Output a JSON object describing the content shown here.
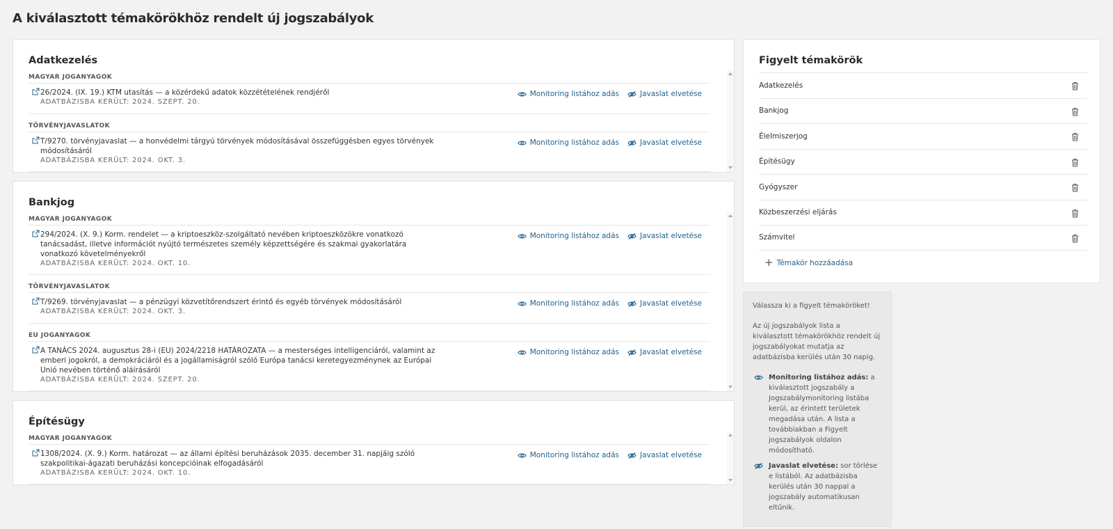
{
  "page_title": "A kiválasztott témakörökhöz rendelt új jogszabályok",
  "action_labels": {
    "monitor": "Monitoring listához adás",
    "reject": "Javaslat elvetése"
  },
  "cards": [
    {
      "title": "Adatkezelés",
      "sections": [
        {
          "label": "MAGYAR JOGANYAGOK",
          "entries": [
            {
              "title": "26/2024. (IX. 19.) KTM utasítás — a közérdekű adatok közzétételének rendjéről",
              "date": "ADATBÁZISBA KERÜLT: 2024. SZEPT. 20."
            }
          ]
        },
        {
          "label": "TÖRVÉNYJAVASLATOK",
          "entries": [
            {
              "title": "T/9270. törvényjavaslat — a honvédelmi tárgyú törvények módosításával összefüggésben egyes törvények módosításáról",
              "date": "ADATBÁZISBA KERÜLT: 2024. OKT. 3."
            }
          ]
        }
      ]
    },
    {
      "title": "Bankjog",
      "sections": [
        {
          "label": "MAGYAR JOGANYAGOK",
          "entries": [
            {
              "title": "294/2024. (X. 9.) Korm. rendelet — a kriptoeszköz-szolgáltató nevében kriptoeszközökre vonatkozó tanácsadást, illetve információt nyújtó természetes személy képzettségére és szakmai gyakorlatára vonatkozó követelményekről",
              "date": "ADATBÁZISBA KERÜLT: 2024. OKT. 10."
            }
          ]
        },
        {
          "label": "TÖRVÉNYJAVASLATOK",
          "entries": [
            {
              "title": "T/9269. törvényjavaslat — a pénzügyi közvetítőrendszert érintő és egyéb törvények módosításáról",
              "date": "ADATBÁZISBA KERÜLT: 2024. OKT. 3."
            }
          ]
        },
        {
          "label": "EU JOGANYAGOK",
          "entries": [
            {
              "title": "A TANÁCS 2024. augusztus 28-i (EU) 2024/2218 HATÁROZATA — a mesterséges intelligenciáról, valamint az emberi jogokról, a demokráciáról és a jogállamiságról szóló Európa tanácsi keretegyezménynek az Európai Unió nevében történő aláírásáról",
              "date": "ADATBÁZISBA KERÜLT: 2024. SZEPT. 20."
            }
          ]
        }
      ]
    },
    {
      "title": "Építésügy",
      "sections": [
        {
          "label": "MAGYAR JOGANYAGOK",
          "entries": [
            {
              "title": "1308/2024. (X. 9.) Korm. határozat — az állami építési beruházások 2035. december 31. napjáig szóló szakpolitikai-ágazati beruházási koncepcióinak elfogadásáról",
              "date": "ADATBÁZISBA KERÜLT: 2024. OKT. 10."
            }
          ]
        }
      ]
    }
  ],
  "topics": {
    "title": "Figyelt témakörök",
    "items": [
      "Adatkezelés",
      "Bankjog",
      "Élelmiszerjog",
      "Építésügy",
      "Gyógyszer",
      "Közbeszerzési eljárás",
      "Számvitel"
    ],
    "add_label": "Témakör hozzáadása"
  },
  "help": {
    "intro": "Válassza ki a figyelt témaköröket!",
    "description": "Az új jogszabályok lista a kiválasztott témakörökhöz rendelt új jogszabályokat mutatja az adatbázisba kerülés után 30 napig.",
    "monitor_term": "Monitoring listához adás:",
    "monitor_text": " a kiválasztott jogszabály a Jogszabálymonitoring listába kerül, az érintett területek megadása után. A lista a továbbiakban a Figyelt jogszabályok oldalon módosítható.",
    "reject_term": "Javaslat elvetése:",
    "reject_text": " sor törlése e listából. Az adatbázisba kerülés után 30 nappal a jogszabály automatikusan eltűnik."
  }
}
